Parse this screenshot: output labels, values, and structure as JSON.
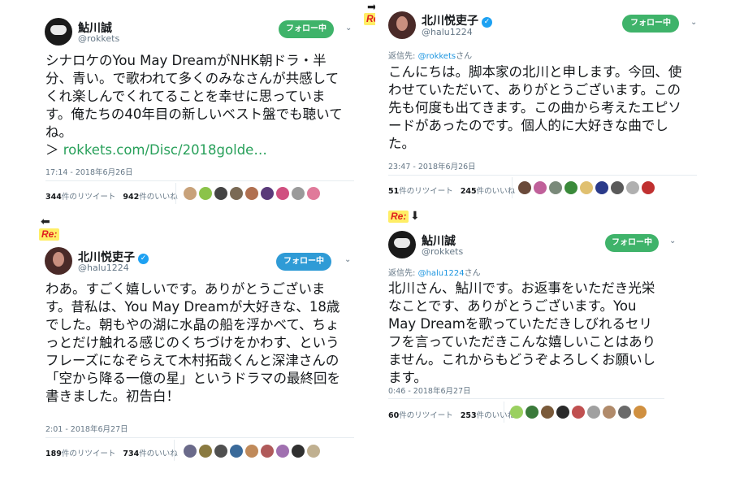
{
  "colors": {
    "follow_green": "#3fb36a",
    "follow_blue": "#2f9bd6",
    "link": "#28a05a",
    "mention": "#1b95e0",
    "re_text": "#e02020",
    "re_bg": "#ffee66"
  },
  "re_label": "Re:",
  "arrows": {
    "right": "➡",
    "left": "⬅",
    "down": "⬇"
  },
  "tweets": [
    {
      "name": "鮎川誠",
      "handle": "@rokkets",
      "follow": "フォロー中",
      "body": "シナロケのYou May DreamがNHK朝ドラ・半分、青い。で歌われて多くのみなさんが共感してくれ楽しんでくれてることを幸せに思っています。俺たちの40年目の新しいベスト盤でも聴いてね。",
      "link_prefix": "＞ ",
      "link": "rokkets.com/Disc/2018golde…",
      "time": "17:14 - 2018年6月26日",
      "retweets": "344",
      "retweets_label": "件のリツイート",
      "likes": "942",
      "likes_label": "件のいいね"
    },
    {
      "name": "北川悦吏子",
      "handle": "@halu1224",
      "follow": "フォロー中",
      "body": "わあ。すごく嬉しいです。ありがとうございます。昔私は、You May Dreamが大好きな、18歳でした。朝もやの湖に水晶の船を浮かべて、ちょっとだけ触れる感じのくちづけをかわす、というフレーズになぞらえて木村拓哉くんと深津さんの「空から降る一億の星」というドラマの最終回を書きました。初告白！",
      "time": "2:01 - 2018年6月27日",
      "retweets": "189",
      "retweets_label": "件のリツイート",
      "likes": "734",
      "likes_label": "件のいいね"
    },
    {
      "name": "北川悦吏子",
      "handle": "@halu1224",
      "follow": "フォロー中",
      "reply_prefix": "返信先: ",
      "reply_to": "@rokkets",
      "reply_suffix": "さん",
      "body": "こんにちは。脚本家の北川と申します。今回、使わせていただいて、ありがとうございます。この先も何度も出てきます。この曲から考えたエピソードがあったのです。個人的に大好きな曲でした。",
      "time": "23:47 - 2018年6月26日",
      "retweets": "51",
      "retweets_label": "件のリツイート",
      "likes": "245",
      "likes_label": "件のいいね"
    },
    {
      "name": "鮎川誠",
      "handle": "@rokkets",
      "follow": "フォロー中",
      "reply_prefix": "返信先: ",
      "reply_to": "@halu1224",
      "reply_suffix": "さん",
      "body": "北川さん、鮎川です。お返事をいただき光栄なことです、ありがとうございます。You May Dreamを歌っていただきしびれるセリフを言っていただきこんな嬉しいことはありません。これからもどうぞよろしくお願いします。",
      "time": "0:46 - 2018年6月27日",
      "retweets": "60",
      "retweets_label": "件のリツイート",
      "likes": "253",
      "likes_label": "件のいいね"
    }
  ]
}
